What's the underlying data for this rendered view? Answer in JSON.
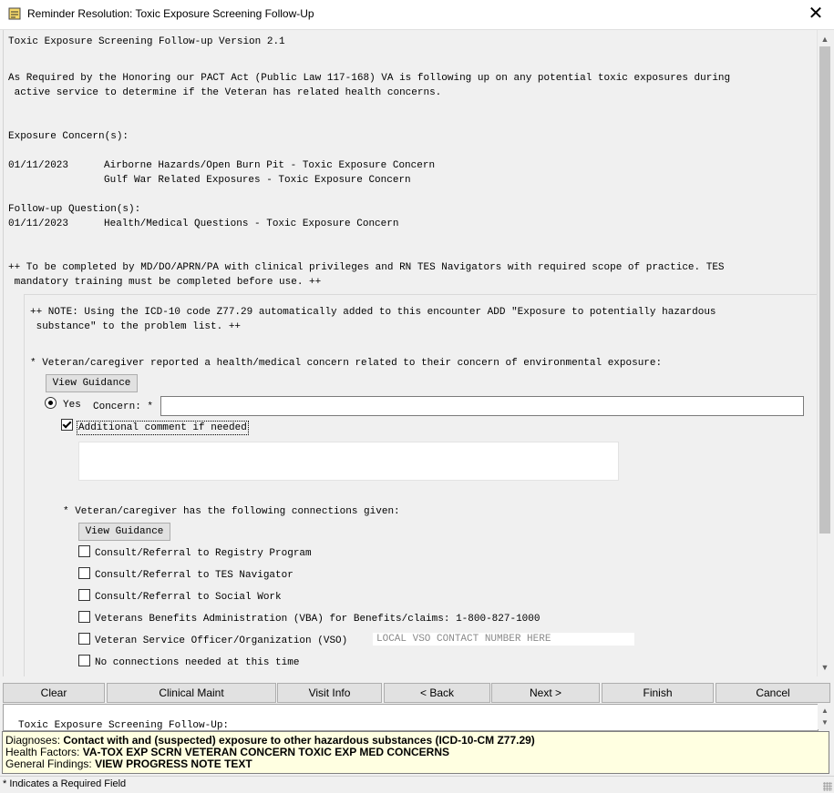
{
  "window": {
    "title": "Reminder Resolution: Toxic Exposure Screening Follow-Up",
    "close_symbol": "✕"
  },
  "content": {
    "header": "Toxic Exposure Screening Follow-up Version 2.1",
    "intro_line1": "As Required by the Honoring our PACT Act (Public Law 117-168) VA is following up on any potential toxic exposures during",
    "intro_line2": " active service to determine if the Veteran has related health concerns.",
    "exposure_heading": "Exposure Concern(s):",
    "exposures": [
      {
        "date": "01/11/2023",
        "text": "Airborne Hazards/Open Burn Pit - Toxic Exposure Concern"
      },
      {
        "date": "",
        "text": "Gulf War Related Exposures - Toxic Exposure Concern"
      }
    ],
    "followup_heading": "Follow-up Question(s):",
    "followups": [
      {
        "date": "01/11/2023",
        "text": "Health/Medical Questions - Toxic Exposure Concern"
      }
    ],
    "completion_line1": "++ To be completed by MD/DO/APRN/PA with clinical privileges and RN TES Navigators with required scope of practice. TES",
    "completion_line2": " mandatory training must be completed before use. ++",
    "note_line1": "++ NOTE: Using the ICD-10 code Z77.29 automatically added to this encounter ADD \"Exposure to potentially hazardous",
    "note_line2": " substance\" to the problem list. ++",
    "concern_question": "* Veteran/caregiver reported a health/medical concern related to their concern of environmental exposure:",
    "view_guidance_label": "View Guidance",
    "yes_label": "Yes",
    "concern_label": "Concern: *",
    "concern_value": "",
    "additional_comment_label": "Additional comment if needed",
    "additional_comment_value": "",
    "connections_question": "* Veteran/caregiver has the following connections given:",
    "connections": [
      {
        "label": "Consult/Referral to Registry Program",
        "checked": false
      },
      {
        "label": "Consult/Referral to TES Navigator",
        "checked": false
      },
      {
        "label": "Consult/Referral to Social Work",
        "checked": false
      },
      {
        "label": "Veterans Benefits Administration (VBA) for Benefits/claims: 1-800-827-1000",
        "checked": false
      },
      {
        "label": "Veteran Service Officer/Organization (VSO)",
        "checked": false
      },
      {
        "label": "No connections needed at this time",
        "checked": false
      }
    ],
    "vso_placeholder": "LOCAL VSO CONTACT NUMBER HERE"
  },
  "nav": {
    "clear": "Clear",
    "clinical_maint": "Clinical Maint",
    "visit_info": "Visit Info",
    "back": "< Back",
    "next": "Next >",
    "finish": "Finish",
    "cancel": "Cancel"
  },
  "preview": {
    "text": "Toxic Exposure Screening Follow-Up:"
  },
  "findings": {
    "diagnoses_label": "Diagnoses: ",
    "diagnoses_value": "Contact with and (suspected) exposure to other hazardous substances (ICD-10-CM Z77.29)",
    "health_factors_label": "Health Factors: ",
    "health_factors_value": "VA-TOX EXP SCRN VETERAN CONCERN TOXIC EXP MED CONCERNS",
    "general_findings_label": "General Findings: ",
    "general_findings_value": "VIEW PROGRESS NOTE TEXT"
  },
  "status": {
    "required_note": "* Indicates a Required Field"
  }
}
